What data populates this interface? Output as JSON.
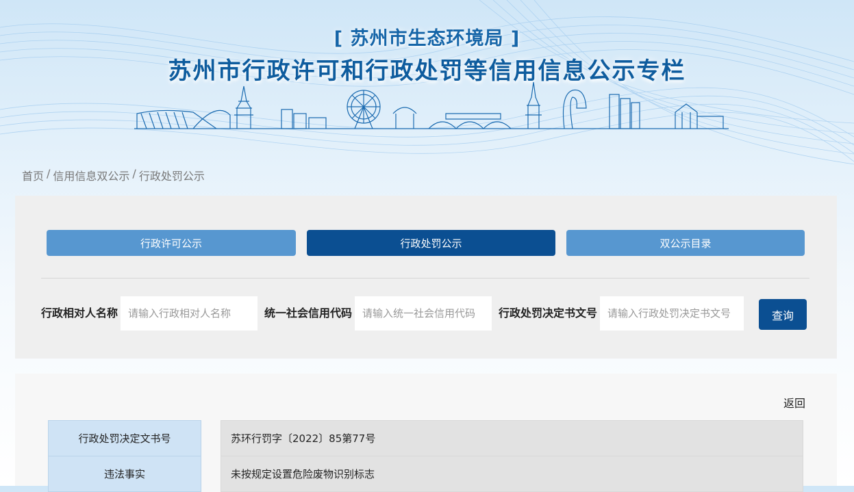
{
  "header": {
    "subtitle": "[ 苏州市生态环境局 ]",
    "title": "苏州市行政许可和行政处罚等信用信息公示专栏"
  },
  "breadcrumb": {
    "home": "首页",
    "separator": "/",
    "level2": "信用信息双公示",
    "level3": "行政处罚公示"
  },
  "tabs": [
    {
      "label": "行政许可公示",
      "active": false
    },
    {
      "label": "行政处罚公示",
      "active": true
    },
    {
      "label": "双公示目录",
      "active": false
    }
  ],
  "search": {
    "name_label": "行政相对人名称",
    "name_placeholder": "请输入行政相对人名称",
    "code_label": "统一社会信用代码",
    "code_placeholder": "请输入统一社会信用代码",
    "doc_label": "行政处罚决定书文号",
    "doc_placeholder": "请输入行政处罚决定书文号",
    "query_label": "查询"
  },
  "detail": {
    "back_label": "返回",
    "rows": [
      {
        "key": "行政处罚决定文书号",
        "value": "苏环行罚字〔2022〕85第77号"
      },
      {
        "key": "违法事实",
        "value": "未按规定设置危险废物识别标志"
      }
    ]
  },
  "colors": {
    "primary_dark": "#0b4f92",
    "primary_light": "#5797d0",
    "title_blue": "#0e5c9e"
  }
}
